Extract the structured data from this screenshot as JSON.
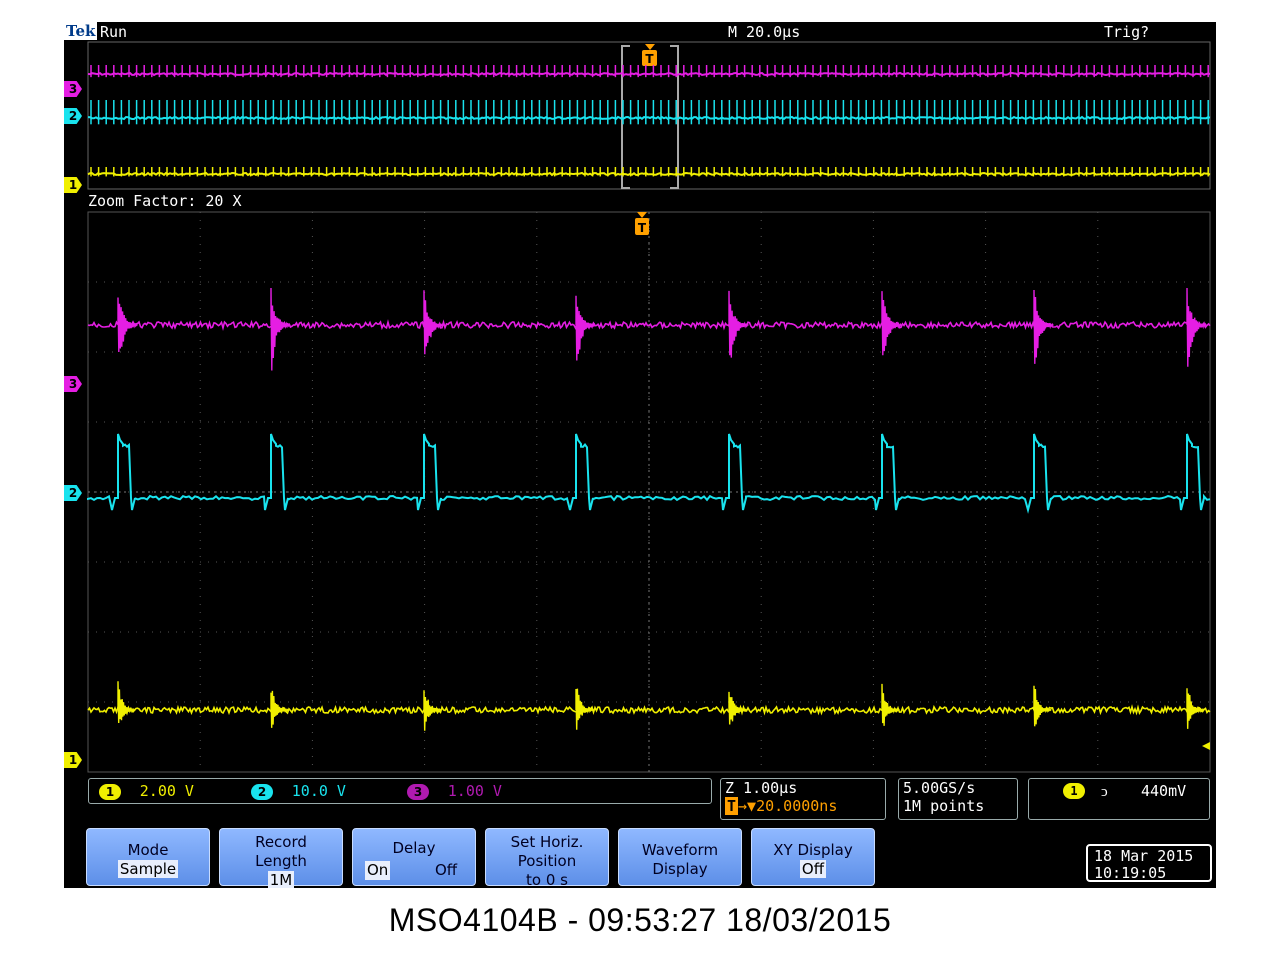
{
  "status": {
    "brand": "Tek",
    "run_state": "Run",
    "timebase": "M 20.0µs",
    "trigger_state": "Trig?"
  },
  "zoom": {
    "title": "Zoom Factor: 20 X",
    "trigger_marker": "T"
  },
  "channels": [
    {
      "id": "1",
      "color": "#f0ef00",
      "scale": "2.00 V"
    },
    {
      "id": "2",
      "color": "#19e3ee",
      "scale": "10.0 V"
    },
    {
      "id": "3",
      "color": "#e51ee3",
      "scale": "1.00 V"
    }
  ],
  "zoom_readout": {
    "line1": "Z 1.00µs",
    "line2": "→▼20.0000ns",
    "marker": "T"
  },
  "acquisition": {
    "sample_rate": "5.00GS/s",
    "record": "1M points"
  },
  "trigger_readout": {
    "channel": "1",
    "slope": "ↄ",
    "level": "440mV"
  },
  "softkeys": {
    "mode_label": "Mode",
    "mode_value": "Sample",
    "record_label_1": "Record",
    "record_label_2": "Length",
    "record_value": "1M",
    "delay_label": "Delay",
    "delay_on": "On",
    "delay_off": "Off",
    "horiz_1": "Set Horiz.",
    "horiz_2": "Position",
    "horiz_3": "to 0 s",
    "waveform_1": "Waveform",
    "waveform_2": "Display",
    "xy_label": "XY Display",
    "xy_value": "Off"
  },
  "datetime": {
    "date": "18 Mar 2015",
    "time": "10:19:05"
  },
  "caption": "MSO4104B - 09:53:27   18/03/2015"
}
